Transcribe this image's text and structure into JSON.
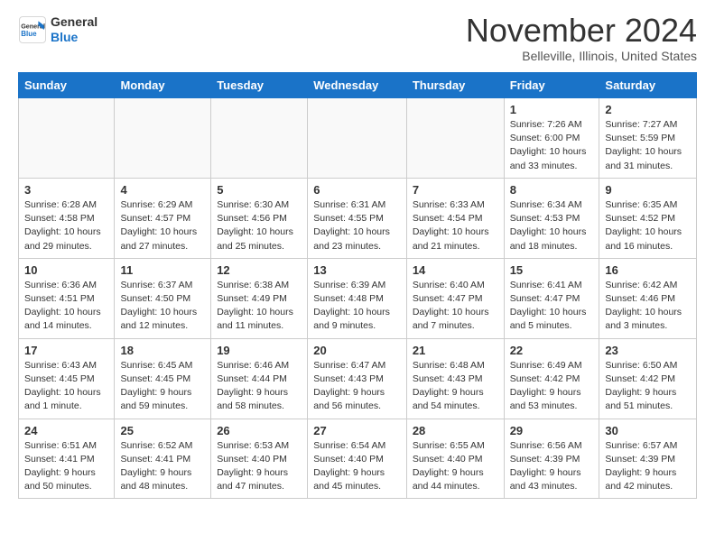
{
  "header": {
    "logo_line1": "General",
    "logo_line2": "Blue",
    "month_title": "November 2024",
    "location": "Belleville, Illinois, United States"
  },
  "weekdays": [
    "Sunday",
    "Monday",
    "Tuesday",
    "Wednesday",
    "Thursday",
    "Friday",
    "Saturday"
  ],
  "weeks": [
    [
      {
        "day": "",
        "info": ""
      },
      {
        "day": "",
        "info": ""
      },
      {
        "day": "",
        "info": ""
      },
      {
        "day": "",
        "info": ""
      },
      {
        "day": "",
        "info": ""
      },
      {
        "day": "1",
        "info": "Sunrise: 7:26 AM\nSunset: 6:00 PM\nDaylight: 10 hours\nand 33 minutes."
      },
      {
        "day": "2",
        "info": "Sunrise: 7:27 AM\nSunset: 5:59 PM\nDaylight: 10 hours\nand 31 minutes."
      }
    ],
    [
      {
        "day": "3",
        "info": "Sunrise: 6:28 AM\nSunset: 4:58 PM\nDaylight: 10 hours\nand 29 minutes."
      },
      {
        "day": "4",
        "info": "Sunrise: 6:29 AM\nSunset: 4:57 PM\nDaylight: 10 hours\nand 27 minutes."
      },
      {
        "day": "5",
        "info": "Sunrise: 6:30 AM\nSunset: 4:56 PM\nDaylight: 10 hours\nand 25 minutes."
      },
      {
        "day": "6",
        "info": "Sunrise: 6:31 AM\nSunset: 4:55 PM\nDaylight: 10 hours\nand 23 minutes."
      },
      {
        "day": "7",
        "info": "Sunrise: 6:33 AM\nSunset: 4:54 PM\nDaylight: 10 hours\nand 21 minutes."
      },
      {
        "day": "8",
        "info": "Sunrise: 6:34 AM\nSunset: 4:53 PM\nDaylight: 10 hours\nand 18 minutes."
      },
      {
        "day": "9",
        "info": "Sunrise: 6:35 AM\nSunset: 4:52 PM\nDaylight: 10 hours\nand 16 minutes."
      }
    ],
    [
      {
        "day": "10",
        "info": "Sunrise: 6:36 AM\nSunset: 4:51 PM\nDaylight: 10 hours\nand 14 minutes."
      },
      {
        "day": "11",
        "info": "Sunrise: 6:37 AM\nSunset: 4:50 PM\nDaylight: 10 hours\nand 12 minutes."
      },
      {
        "day": "12",
        "info": "Sunrise: 6:38 AM\nSunset: 4:49 PM\nDaylight: 10 hours\nand 11 minutes."
      },
      {
        "day": "13",
        "info": "Sunrise: 6:39 AM\nSunset: 4:48 PM\nDaylight: 10 hours\nand 9 minutes."
      },
      {
        "day": "14",
        "info": "Sunrise: 6:40 AM\nSunset: 4:47 PM\nDaylight: 10 hours\nand 7 minutes."
      },
      {
        "day": "15",
        "info": "Sunrise: 6:41 AM\nSunset: 4:47 PM\nDaylight: 10 hours\nand 5 minutes."
      },
      {
        "day": "16",
        "info": "Sunrise: 6:42 AM\nSunset: 4:46 PM\nDaylight: 10 hours\nand 3 minutes."
      }
    ],
    [
      {
        "day": "17",
        "info": "Sunrise: 6:43 AM\nSunset: 4:45 PM\nDaylight: 10 hours\nand 1 minute."
      },
      {
        "day": "18",
        "info": "Sunrise: 6:45 AM\nSunset: 4:45 PM\nDaylight: 9 hours\nand 59 minutes."
      },
      {
        "day": "19",
        "info": "Sunrise: 6:46 AM\nSunset: 4:44 PM\nDaylight: 9 hours\nand 58 minutes."
      },
      {
        "day": "20",
        "info": "Sunrise: 6:47 AM\nSunset: 4:43 PM\nDaylight: 9 hours\nand 56 minutes."
      },
      {
        "day": "21",
        "info": "Sunrise: 6:48 AM\nSunset: 4:43 PM\nDaylight: 9 hours\nand 54 minutes."
      },
      {
        "day": "22",
        "info": "Sunrise: 6:49 AM\nSunset: 4:42 PM\nDaylight: 9 hours\nand 53 minutes."
      },
      {
        "day": "23",
        "info": "Sunrise: 6:50 AM\nSunset: 4:42 PM\nDaylight: 9 hours\nand 51 minutes."
      }
    ],
    [
      {
        "day": "24",
        "info": "Sunrise: 6:51 AM\nSunset: 4:41 PM\nDaylight: 9 hours\nand 50 minutes."
      },
      {
        "day": "25",
        "info": "Sunrise: 6:52 AM\nSunset: 4:41 PM\nDaylight: 9 hours\nand 48 minutes."
      },
      {
        "day": "26",
        "info": "Sunrise: 6:53 AM\nSunset: 4:40 PM\nDaylight: 9 hours\nand 47 minutes."
      },
      {
        "day": "27",
        "info": "Sunrise: 6:54 AM\nSunset: 4:40 PM\nDaylight: 9 hours\nand 45 minutes."
      },
      {
        "day": "28",
        "info": "Sunrise: 6:55 AM\nSunset: 4:40 PM\nDaylight: 9 hours\nand 44 minutes."
      },
      {
        "day": "29",
        "info": "Sunrise: 6:56 AM\nSunset: 4:39 PM\nDaylight: 9 hours\nand 43 minutes."
      },
      {
        "day": "30",
        "info": "Sunrise: 6:57 AM\nSunset: 4:39 PM\nDaylight: 9 hours\nand 42 minutes."
      }
    ]
  ]
}
